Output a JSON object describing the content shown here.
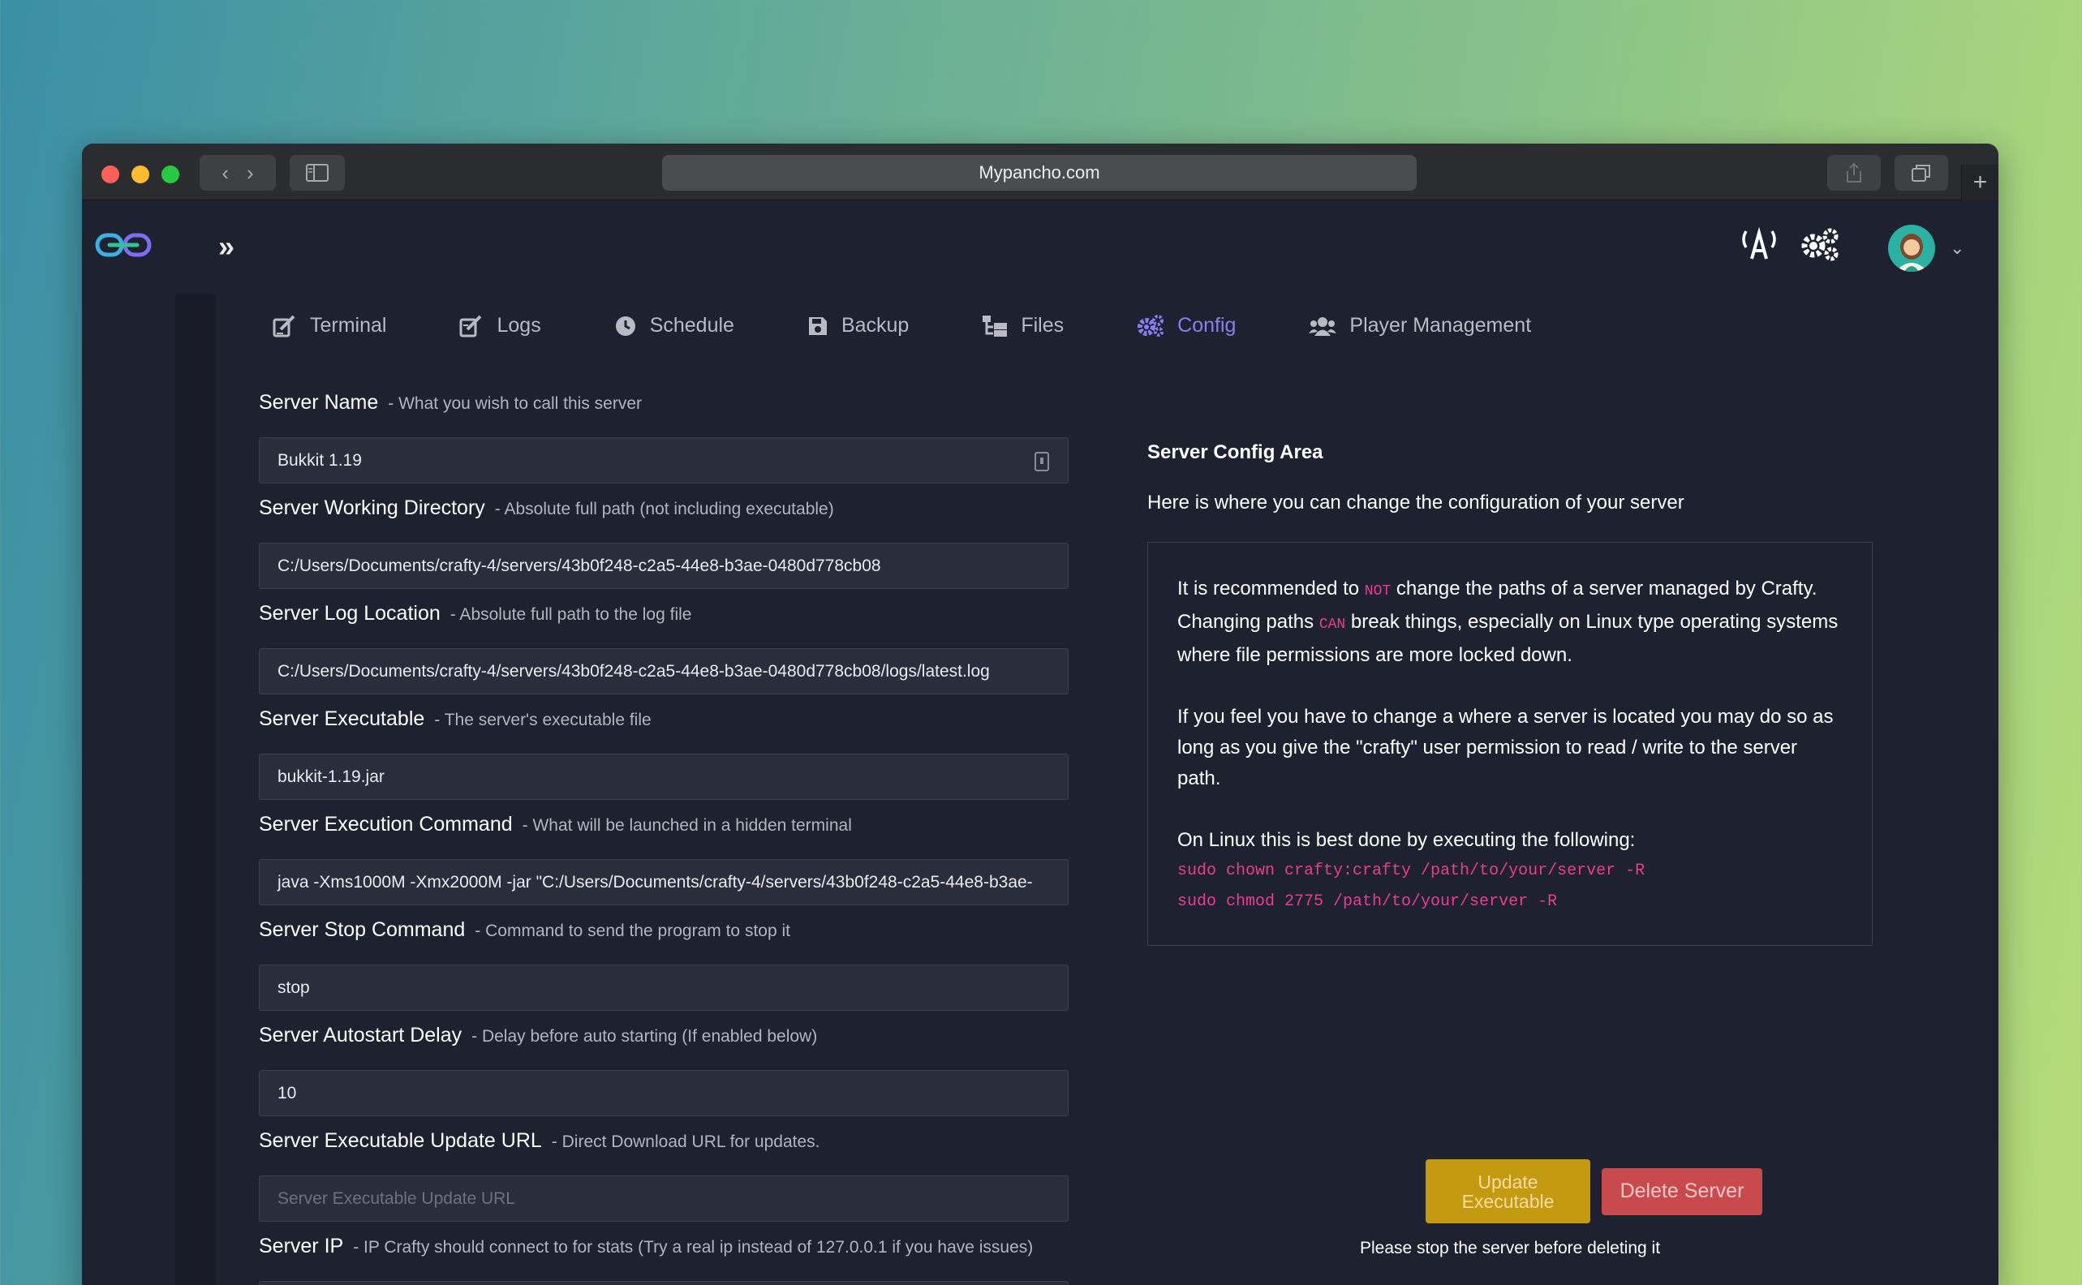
{
  "browser": {
    "url": "Mypancho.com"
  },
  "tabs": [
    {
      "label": "Terminal",
      "icon": "terminal-edit-icon"
    },
    {
      "label": "Logs",
      "icon": "logs-edit-icon"
    },
    {
      "label": "Schedule",
      "icon": "clock-icon"
    },
    {
      "label": "Backup",
      "icon": "save-icon"
    },
    {
      "label": "Files",
      "icon": "folder-tree-icon"
    },
    {
      "label": "Config",
      "icon": "cogs-icon",
      "active": true
    },
    {
      "label": "Player Management",
      "icon": "users-icon"
    }
  ],
  "form": {
    "server_name": {
      "label": "Server Name",
      "hint": "- What you wish to call this server",
      "value": "Bukkit 1.19"
    },
    "working_dir": {
      "label": "Server Working Directory",
      "hint": "- Absolute full path (not including executable)",
      "value": "C:/Users/Documents/crafty-4/servers/43b0f248-c2a5-44e8-b3ae-0480d778cb08"
    },
    "log_location": {
      "label": "Server Log Location",
      "hint": "- Absolute full path to the log file",
      "value": "C:/Users/Documents/crafty-4/servers/43b0f248-c2a5-44e8-b3ae-0480d778cb08/logs/latest.log"
    },
    "executable": {
      "label": "Server Executable",
      "hint": "- The server's executable file",
      "value": "bukkit-1.19.jar"
    },
    "exec_command": {
      "label": "Server Execution Command",
      "hint": "- What will be launched in a hidden terminal",
      "value": "java -Xms1000M -Xmx2000M -jar \"C:/Users/Documents/crafty-4/servers/43b0f248-c2a5-44e8-b3ae-"
    },
    "stop_command": {
      "label": "Server Stop Command",
      "hint": "- Command to send the program to stop it",
      "value": "stop"
    },
    "autostart_delay": {
      "label": "Server Autostart Delay",
      "hint": "- Delay before auto starting (If enabled below)",
      "value": "10"
    },
    "update_url": {
      "label": "Server Executable Update URL",
      "hint": "- Direct Download URL for updates.",
      "placeholder": "Server Executable Update URL"
    },
    "server_ip": {
      "label": "Server IP",
      "hint": "- IP Crafty should connect to for stats (Try a real ip instead of 127.0.0.1 if you have issues)"
    }
  },
  "config_area": {
    "title": "Server Config Area",
    "description": "Here is where you can change the configuration of your server",
    "notice": {
      "p1_a": "It is recommended to ",
      "p1_not": "NOT",
      "p1_b": " change the paths of a server managed by Crafty. Changing paths ",
      "p1_can": "CAN",
      "p1_c": " break things, especially on Linux type operating systems where file permissions are more locked down.",
      "p2": "If you feel you have to change a where a server is located you may do so as long as you give the \"crafty\" user permission to read / write to the server path.",
      "p3": "On Linux this is best done by executing the following:",
      "code1": "sudo chown crafty:crafty /path/to/your/server -R",
      "code2": "sudo chmod 2775 /path/to/your/server -R"
    }
  },
  "actions": {
    "update_line1": "Update",
    "update_line2": "Executable",
    "delete": "Delete Server",
    "stop_note": "Please stop the server before deleting it"
  },
  "colors": {
    "accent": "#8d7cf0",
    "warning": "#c49a11",
    "danger": "#c84a4d",
    "code": "#e83e8c"
  }
}
